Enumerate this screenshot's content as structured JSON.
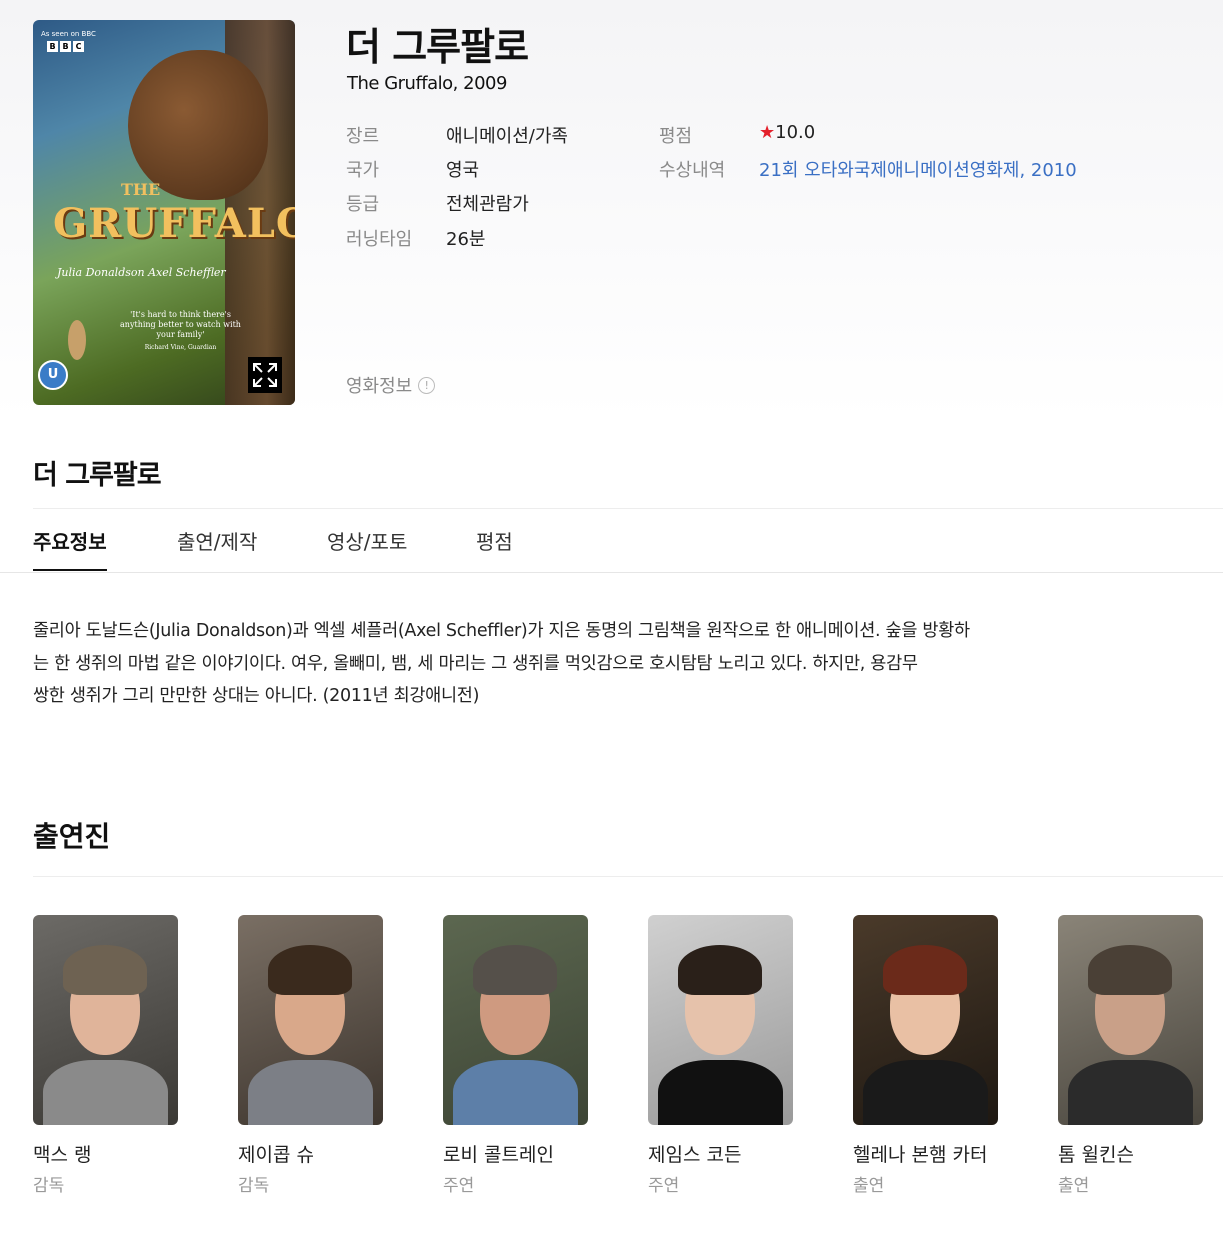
{
  "movie": {
    "title_ko": "더 그루팔로",
    "title_en_year": "The Gruffalo, 2009",
    "poster": {
      "bbc_caption": "As seen on BBC",
      "bbc_letters": [
        "B",
        "B",
        "C"
      ],
      "title_the": "THE",
      "title_main": "GRUFFALO",
      "authors": "Julia Donaldson  Axel Scheffler",
      "quote": "'It's hard to think there's anything better to watch with your family'",
      "quote_source": "Richard Vine, Guardian",
      "age_badge": "U"
    },
    "info_left": [
      {
        "key": "장르",
        "value": "애니메이션/가족"
      },
      {
        "key": "국가",
        "value": "영국"
      },
      {
        "key": "등급",
        "value": "전체관람가"
      },
      {
        "key": "러닝타임",
        "value": "26분"
      }
    ],
    "info_right": {
      "rating_key": "평점",
      "rating_value": "10.0",
      "awards_key": "수상내역",
      "awards_value": "21회 오타와국제애니메이션영화제, 2010"
    },
    "movie_info_label": "영화정보"
  },
  "section_title": "더 그루팔로",
  "tabs": [
    "주요정보",
    "출연/제작",
    "영상/포토",
    "평점"
  ],
  "synopsis_lines": [
    "줄리아 도날드슨(Julia Donaldson)과 엑셀 셰플러(Axel Scheffler)가 지은 동명의 그림책을 원작으로 한 애니메이션. 숲을 방황하",
    "는 한 생쥐의 마법 같은 이야기이다. 여우, 올빼미, 뱀, 세 마리는 그 생쥐를 먹잇감으로 호시탐탐 노리고 있다. 하지만, 용감무",
    "쌍한 생쥐가 그리 만만한 상대는 아니다. (2011년 최강애니전)"
  ],
  "cast_title": "출연진",
  "cast": [
    {
      "name": "맥스 랭",
      "role": "감독"
    },
    {
      "name": "제이콥 슈",
      "role": "감독"
    },
    {
      "name": "로비 콜트레인",
      "role": "주연"
    },
    {
      "name": "제임스 코든",
      "role": "주연"
    },
    {
      "name": "헬레나 본햄 카터",
      "role": "출연"
    },
    {
      "name": "톰 윌킨슨",
      "role": "출연"
    }
  ],
  "colors": {
    "link": "#3a6fc4",
    "star": "#e4202b",
    "muted": "#8a8a8a"
  }
}
